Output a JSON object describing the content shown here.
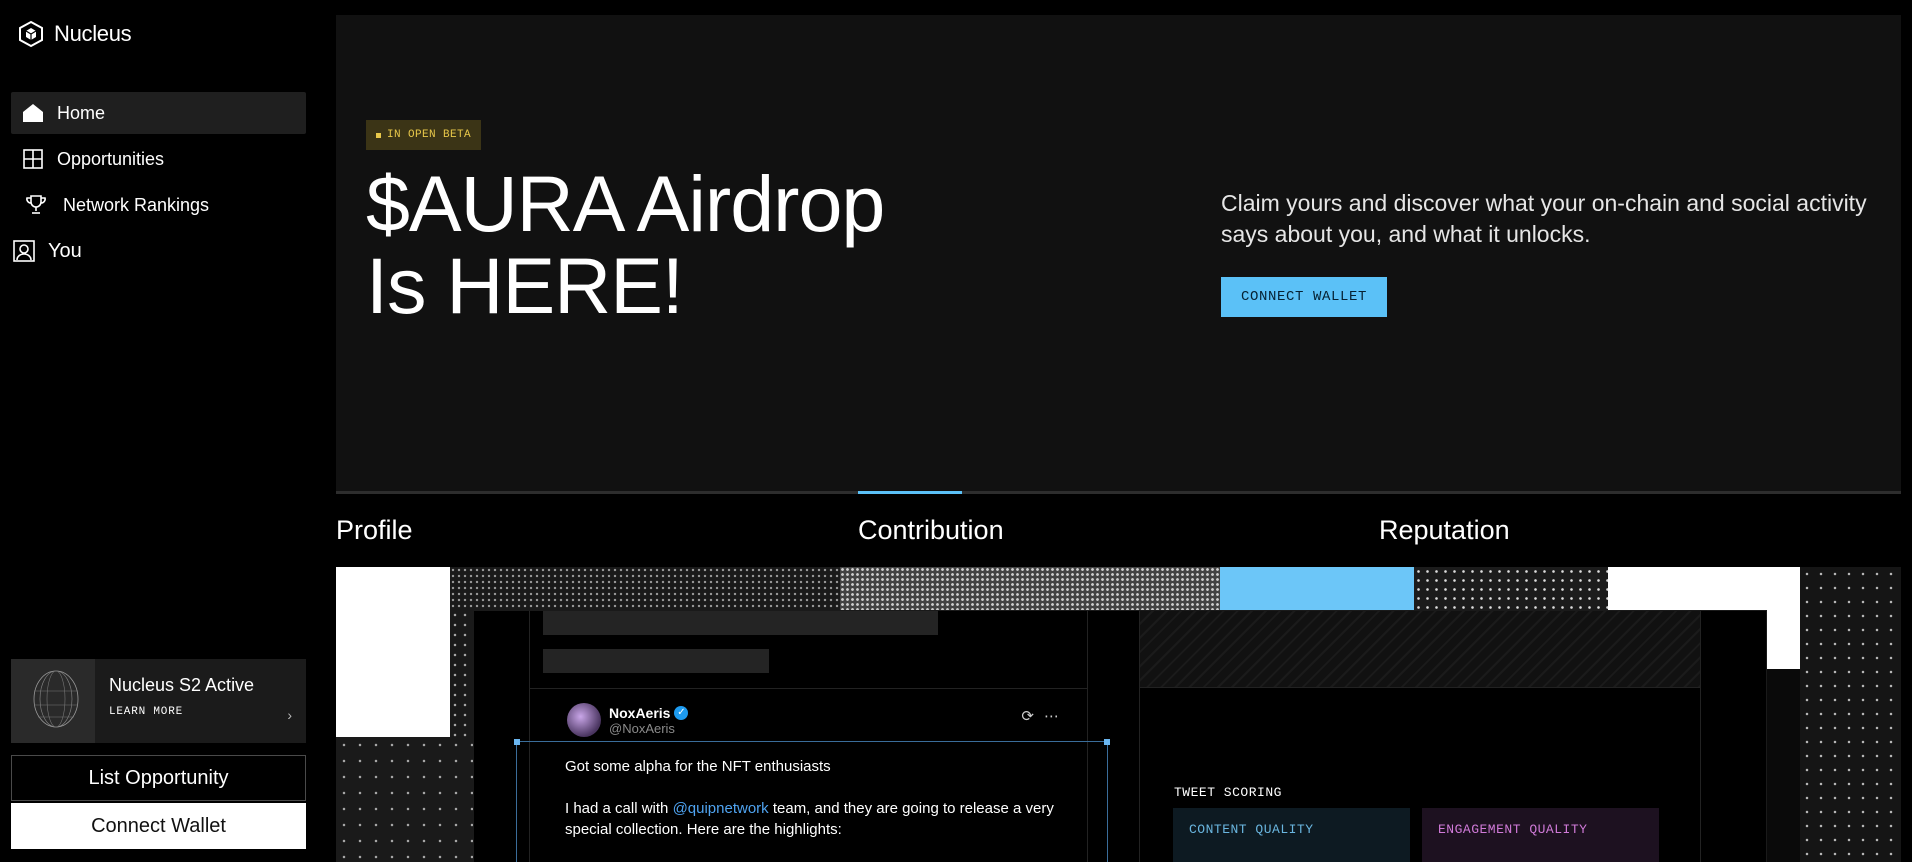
{
  "app": {
    "name": "Nucleus"
  },
  "sidebar": {
    "items": [
      {
        "label": "Home",
        "icon": "home-icon",
        "active": true
      },
      {
        "label": "Opportunities",
        "icon": "grid-icon",
        "active": false
      },
      {
        "label": "Network Rankings",
        "icon": "trophy-icon",
        "active": false
      },
      {
        "label": "You",
        "icon": "user-icon",
        "active": false
      }
    ],
    "promo": {
      "title": "Nucleus S2 Active",
      "link": "LEARN MORE"
    },
    "list_opportunity": "List Opportunity",
    "connect_wallet": "Connect Wallet"
  },
  "hero": {
    "badge": "IN OPEN BETA",
    "headline_line1": "$AURA Airdrop",
    "headline_line2": "Is HERE!",
    "description": "Claim yours and discover what your on-chain and social activity says about you, and what it unlocks.",
    "cta": "CONNECT WALLET"
  },
  "tabs": [
    {
      "label": "Profile",
      "active": false
    },
    {
      "label": "Contribution",
      "active": true
    },
    {
      "label": "Reputation",
      "active": false
    }
  ],
  "showcase": {
    "tweet": {
      "name": "NoxAeris",
      "handle": "@NoxAeris",
      "line1": "Got some alpha for the NFT enthusiasts",
      "line2_before": "I had a call with ",
      "mention": "@quipnetwork",
      "line2_after": " team, and they are going to release a very special collection. Here are the highlights:"
    },
    "scoring": {
      "label": "TWEET SCORING",
      "content_quality": "CONTENT QUALITY",
      "engagement_quality": "ENGAGEMENT QUALITY"
    }
  },
  "colors": {
    "accent": "#5bc1f7",
    "beta_bg": "#3b3416",
    "beta_text": "#e8c84a",
    "hero_bg": "#111111"
  }
}
